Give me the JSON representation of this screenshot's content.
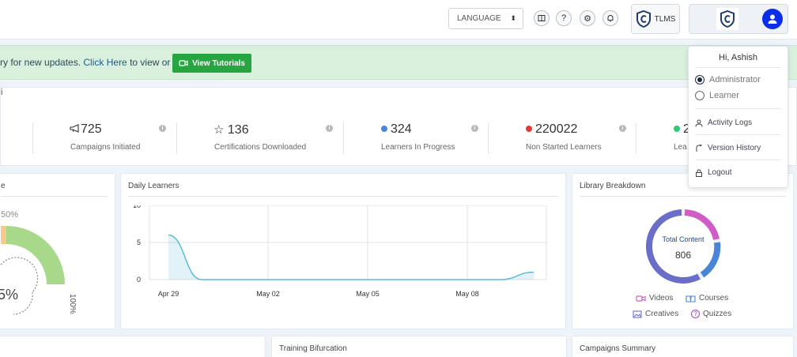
{
  "header": {
    "language_label": "LANGUAGE",
    "icons": [
      "book-icon",
      "help-icon",
      "gear-icon",
      "bell-icon"
    ],
    "tlms_label": "TLMS"
  },
  "banner": {
    "text_prefix": "ry for new updates. ",
    "link_text": "Click Here",
    "text_suffix": " to view or",
    "button_label": "View Tutorials",
    "bg_color": "#d8f0dc",
    "button_color": "#26a541"
  },
  "stats": [
    {
      "value": "725",
      "label": "Campaigns Initiated",
      "icon": "megaphone-icon"
    },
    {
      "value": "136",
      "label": "Certifications Downloaded",
      "icon": "star-icon"
    },
    {
      "value": "324",
      "label": "Learners In Progress",
      "dot_color": "#4a86d8"
    },
    {
      "value": "220022",
      "label": "Non Started Learners",
      "dot_color": "#e53935"
    },
    {
      "value": "2",
      "label": "Lea",
      "dot_color": "#2ecc71"
    }
  ],
  "gauge_card": {
    "title_fragment": "e",
    "top_label": "50%",
    "center_value": "5%",
    "right_label": "100%"
  },
  "daily_learners": {
    "title": "Daily Learners",
    "chart_data": {
      "type": "area",
      "x": [
        "Apr 29",
        "Apr 30",
        "May 01",
        "May 02",
        "May 03",
        "May 04",
        "May 05",
        "May 06",
        "May 07",
        "May 08",
        "May 09",
        "May 10"
      ],
      "x_tick_labels": [
        "Apr 29",
        "May 02",
        "May 05",
        "May 08"
      ],
      "y": [
        6,
        0,
        0,
        0,
        0,
        0,
        0,
        0,
        0,
        0,
        0,
        1
      ],
      "y_ticks": [
        "0",
        "5",
        "10"
      ],
      "ylim": [
        0,
        10
      ],
      "grid": true,
      "color": "#5bbcd8"
    }
  },
  "library": {
    "title": "Library Breakdown",
    "center_label": "Total Content",
    "center_value": "806",
    "legend": [
      {
        "label": "Videos",
        "icon": "video-icon",
        "color": "#d05cc8"
      },
      {
        "label": "Courses",
        "icon": "book-icon",
        "color": "#4a86d8"
      },
      {
        "label": "Creatives",
        "icon": "image-icon",
        "color": "#6a6ec8"
      },
      {
        "label": "Quizzes",
        "icon": "question-icon",
        "color": "#9b4fc8"
      }
    ]
  },
  "bottom_cards": {
    "training": "Training Bifurcation",
    "campaigns": "Campaigns Summary"
  },
  "user_menu": {
    "greeting": "Hi, Ashish",
    "roles": [
      {
        "label": "Administrator",
        "selected": true
      },
      {
        "label": "Learner",
        "selected": false
      }
    ],
    "items": [
      {
        "label": "Activity Logs",
        "icon": "user-icon"
      },
      {
        "label": "Version History",
        "icon": "history-icon"
      },
      {
        "label": "Logout",
        "icon": "lock-icon"
      }
    ]
  }
}
